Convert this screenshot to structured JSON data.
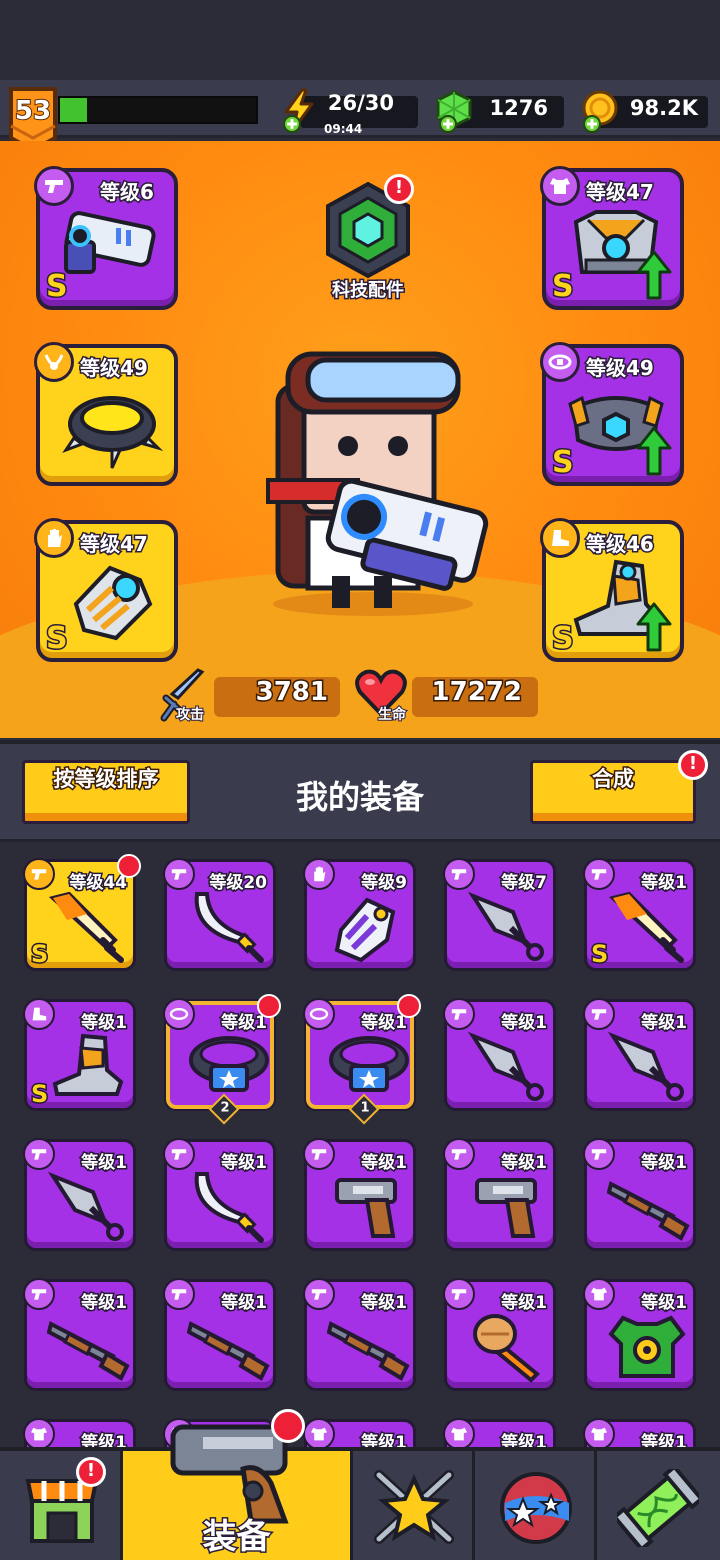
{
  "player": {
    "level": "53",
    "xp_fraction": 0.14
  },
  "resources": {
    "energy": {
      "value": "26/30",
      "timer": "09:44"
    },
    "gems": {
      "value": "1276"
    },
    "coins": {
      "value": "98.2K"
    }
  },
  "hero": {
    "tech_label": "科技配件",
    "attack": {
      "label": "攻击",
      "value": "3781"
    },
    "health": {
      "label": "生命",
      "value": "17272"
    },
    "slots": [
      {
        "id": "weapon",
        "level": "等级6",
        "rank": "S",
        "upgrade": false,
        "color": "purple"
      },
      {
        "id": "armor",
        "level": "等级47",
        "rank": "S",
        "upgrade": true,
        "color": "purple"
      },
      {
        "id": "necklace",
        "level": "等级49",
        "rank": "",
        "upgrade": false,
        "color": "gold"
      },
      {
        "id": "belt",
        "level": "等级49",
        "rank": "S",
        "upgrade": true,
        "color": "purple"
      },
      {
        "id": "gloves",
        "level": "等级47",
        "rank": "S",
        "upgrade": false,
        "color": "gold"
      },
      {
        "id": "boots",
        "level": "等级46",
        "rank": "S",
        "upgrade": true,
        "color": "gold"
      }
    ]
  },
  "inventory": {
    "sort_label": "按等级排序",
    "title": "我的装备",
    "merge_label": "合成",
    "merge_badge": "!",
    "items": [
      {
        "level": "等级44",
        "kind": "sword",
        "rank": "S",
        "color": "gold",
        "crown": true
      },
      {
        "level": "等级20",
        "kind": "scimitar",
        "rank": "",
        "color": "purple"
      },
      {
        "level": "等级9",
        "kind": "glove",
        "rank": "",
        "color": "purple"
      },
      {
        "level": "等级7",
        "kind": "kunai",
        "rank": "",
        "color": "purple"
      },
      {
        "level": "等级1",
        "kind": "sword",
        "rank": "S",
        "color": "purple"
      },
      {
        "level": "等级1",
        "kind": "boot",
        "rank": "S",
        "color": "purple"
      },
      {
        "level": "等级1",
        "kind": "belt",
        "rank": "",
        "color": "framed",
        "count": "2",
        "crown": true
      },
      {
        "level": "等级1",
        "kind": "belt",
        "rank": "",
        "color": "framed",
        "count": "1",
        "crown": true
      },
      {
        "level": "等级1",
        "kind": "kunai",
        "rank": "",
        "color": "purple"
      },
      {
        "level": "等级1",
        "kind": "kunai",
        "rank": "",
        "color": "purple"
      },
      {
        "level": "等级1",
        "kind": "kunai",
        "rank": "",
        "color": "purple"
      },
      {
        "level": "等级1",
        "kind": "scimitar",
        "rank": "",
        "color": "purple"
      },
      {
        "level": "等级1",
        "kind": "revolver",
        "rank": "",
        "color": "purple"
      },
      {
        "level": "等级1",
        "kind": "revolver",
        "rank": "",
        "color": "purple"
      },
      {
        "level": "等级1",
        "kind": "shotgun",
        "rank": "",
        "color": "purple"
      },
      {
        "level": "等级1",
        "kind": "shotgun",
        "rank": "",
        "color": "purple"
      },
      {
        "level": "等级1",
        "kind": "shotgun",
        "rank": "",
        "color": "purple"
      },
      {
        "level": "等级1",
        "kind": "shotgun",
        "rank": "",
        "color": "purple"
      },
      {
        "level": "等级1",
        "kind": "torch",
        "rank": "",
        "color": "purple"
      },
      {
        "level": "等级1",
        "kind": "vest",
        "rank": "",
        "color": "purple"
      },
      {
        "level": "等级1",
        "kind": "armor",
        "rank": "",
        "color": "purple"
      },
      {
        "level": "等级1",
        "kind": "armor",
        "rank": "",
        "color": "purple"
      },
      {
        "level": "等级1",
        "kind": "armor",
        "rank": "",
        "color": "purple"
      },
      {
        "level": "等级1",
        "kind": "armor",
        "rank": "",
        "color": "purple"
      },
      {
        "level": "等级1",
        "kind": "armor",
        "rank": "",
        "color": "purple"
      }
    ]
  },
  "nav": {
    "active_label": "装备",
    "tabs": [
      "shop-icon",
      "equipment-icon",
      "talent-icon",
      "planet-icon",
      "dna-icon"
    ]
  },
  "colors": {
    "accent": "#ffcc1a",
    "hero_bg": "#ff8a10",
    "slot_purple": "#a531e6",
    "slot_gold": "#ffd21c",
    "alert": "#ee2038"
  }
}
